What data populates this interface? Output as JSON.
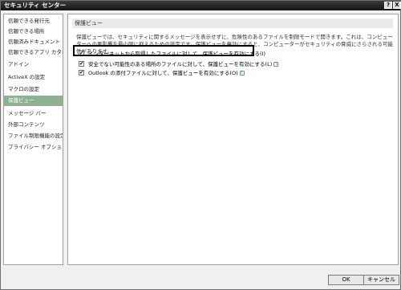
{
  "window": {
    "title": "セキュリティ センター",
    "help_label": "?",
    "close_label": "X"
  },
  "sidebar": {
    "items": [
      {
        "label": "信頼できる発行元"
      },
      {
        "label": "信頼できる場所"
      },
      {
        "label": "信頼済みドキュメント"
      },
      {
        "label": "信頼できるアプリ カタログ"
      },
      {
        "label": "アドイン"
      },
      {
        "label": "ActiveX の設定"
      },
      {
        "label": "マクロの設定"
      },
      {
        "label": "保護ビュー",
        "selected": true
      },
      {
        "label": "メッセージ バー"
      },
      {
        "label": "外部コンテンツ"
      },
      {
        "label": "ファイル制限機能の設定"
      },
      {
        "label": "プライバシー オプション"
      }
    ]
  },
  "main": {
    "section_title": "保護ビュー",
    "description": "保護ビューでは、セキュリティに関するメッセージを表示せずに、危険性のあるファイルを制限モードで開きます。これは、コンピューターへの悪影響を最小限に抑えるための設定です。保護ビューを無効にすると、コンピューターがセキュリティの脅威にさらされる可能性があります。",
    "options": [
      {
        "label": "インターネットから取得したファイルに対して、保護ビューを有効にする(I)",
        "checked": true
      },
      {
        "label": "安全でない可能性のある場所のファイルに対して、保護ビューを有効にする(L)",
        "checked": true
      },
      {
        "label": "Outlook の添付ファイルに対して、保護ビューを有効にする(O)",
        "checked": true
      }
    ],
    "info_icon": "i"
  },
  "buttons": {
    "ok": "OK",
    "cancel": "キャンセル"
  },
  "colors": {
    "selected_nav": "#8db191",
    "title_bar": "#1e1e1e",
    "highlight_border": "#000000"
  },
  "icons": {
    "checkbox_checked": "✔",
    "info": "info-icon"
  }
}
